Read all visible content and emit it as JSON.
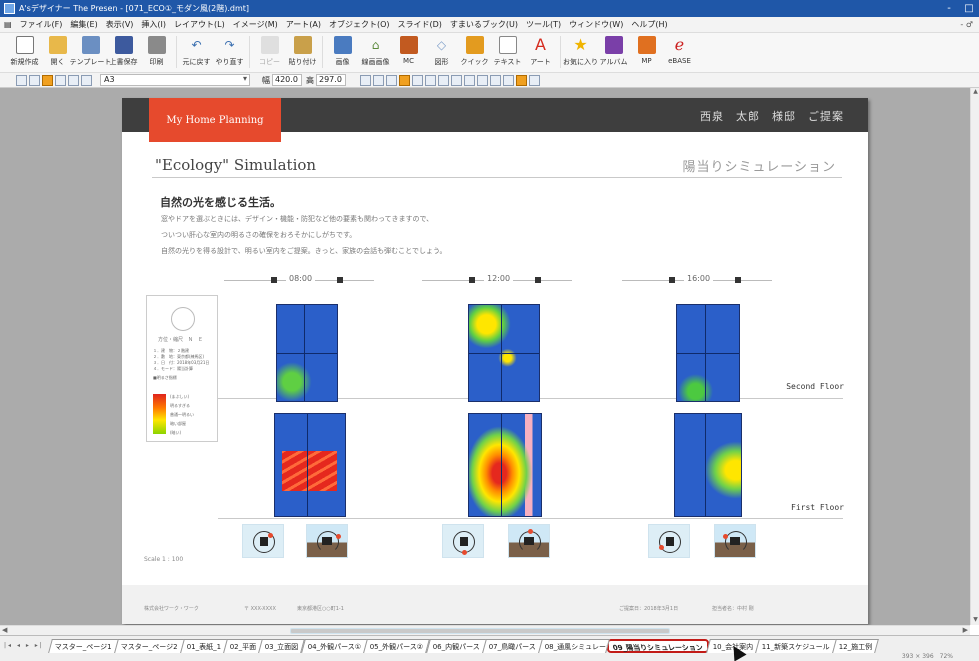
{
  "window": {
    "title": "A'sデザイナー The Presen - [071_ECO①_モダン風(2階).dmt]",
    "controls": [
      "-",
      "□"
    ]
  },
  "menubar": {
    "items": [
      "ファイル(F)",
      "編集(E)",
      "表示(V)",
      "挿入(I)",
      "レイアウト(L)",
      "イメージ(M)",
      "アート(A)",
      "オブジェクト(O)",
      "スライド(D)",
      "すまいるブック(U)",
      "ツール(T)",
      "ウィンドウ(W)",
      "ヘルプ(H)"
    ],
    "mdi_controls": "- ♂"
  },
  "ribbon": {
    "buttons": [
      {
        "label": "新規作成",
        "icon": "new-document-icon",
        "color": "#ffffff"
      },
      {
        "label": "開く",
        "icon": "open-folder-icon",
        "color": "#e8b84a"
      },
      {
        "label": "テンプレート",
        "icon": "template-icon",
        "color": "#6b8fc2"
      },
      {
        "label": "上書保存",
        "icon": "save-icon",
        "color": "#3d5a9e"
      },
      {
        "label": "印刷",
        "icon": "print-icon",
        "color": "#777777"
      },
      {
        "label": "元に戻す",
        "icon": "undo-icon",
        "color": "#3a6fb0"
      },
      {
        "label": "やり直す",
        "icon": "redo-icon",
        "color": "#3a6fb0"
      },
      {
        "label": "コピー",
        "icon": "copy-icon",
        "color": "#bbbbbb"
      },
      {
        "label": "貼り付け",
        "icon": "paste-icon",
        "color": "#c9a04a"
      },
      {
        "label": "画像",
        "icon": "image-icon",
        "color": "#4a7bc0"
      },
      {
        "label": "線画画像",
        "icon": "line-image-icon",
        "color": "#5b8a3c"
      },
      {
        "label": "MC",
        "icon": "mc-icon",
        "color": "#c25a20"
      },
      {
        "label": "図形",
        "icon": "shape-icon",
        "color": "#7f9fc9"
      },
      {
        "label": "クイック",
        "icon": "quick-icon",
        "color": "#e39b1f"
      },
      {
        "label": "テキスト",
        "icon": "text-icon",
        "color": "#888888"
      },
      {
        "label": "アート",
        "icon": "art-text-icon",
        "color": "#d52b1e"
      },
      {
        "label": "お気に入り",
        "icon": "favorite-star-icon",
        "color": "#f0b400"
      },
      {
        "label": "アルバム",
        "icon": "album-icon",
        "color": "#7a3fa8"
      },
      {
        "label": "MP",
        "icon": "mp-icon",
        "color": "#e07020"
      },
      {
        "label": "eBASE",
        "icon": "ebase-icon",
        "color": "#cc2222"
      }
    ]
  },
  "toolbar2": {
    "paper": "A3",
    "width_label": "幅",
    "width_value": "420.0",
    "height_label": "高",
    "height_value": "297.0"
  },
  "page": {
    "brand": "My Home Planning",
    "client": "西泉　太郎　様邸　ご提案",
    "title_en": "\"Ecology\" Simulation",
    "title_jp": "陽当りシミュレーション",
    "headline": "自然の光を感じる生活。",
    "body": [
      "窓やドアを選ぶときには、デザイン・機能・防犯など他の要素も関わってきますので、",
      "ついつい肝心な室内の明るさの確保をおろそかにしがちです。",
      "自然の光りを得る設計で、明るい室内をご提案。きっと、家族の会話も弾むことでしょう。"
    ],
    "times": [
      "08:00",
      "12:00",
      "16:00"
    ],
    "second_floor": "Second Floor",
    "first_floor": "First Floor",
    "legend": {
      "north_label": "方位・縮尺　Ｎ　Ｅ",
      "info": [
        "１．建　物：２階建",
        "２．敷　地：東京都(練馬区)",
        "３．日　付：2018年03月21日",
        "４．モード：陽当計算"
      ],
      "scale_title": "■明るさ指標",
      "scale": [
        "(まぶしい)",
        "明るすぎる",
        "普通～明るい",
        "暗い部屋",
        "(暗い)"
      ]
    },
    "scale_note": "Scale 1 : 100",
    "footer": [
      "株式会社ワーク・ワーク",
      "〒 XXX-XXXX",
      "東京都港区○○町1-1",
      "ご提案日：2018年3月1日",
      "担当者名：中村 剛"
    ]
  },
  "tabs": {
    "nav": "|◂ ◂ ▸ ▸|",
    "items": [
      "マスター_ページ1",
      "マスター_ページ2",
      "01_表紙_1",
      "02_平面",
      "03_立面図",
      "04_外観パース①",
      "05_外観パース②",
      "06_内観パース",
      "07_鳥瞰パース",
      "08_通風シミュレーション",
      "09_陽当りシミュレーション",
      "10_会社案内",
      "11_新築スケジュール",
      "12_施工例"
    ],
    "active": "09_陽当りシミュレーション"
  },
  "status": {
    "coords": "393 × 396　72%"
  }
}
